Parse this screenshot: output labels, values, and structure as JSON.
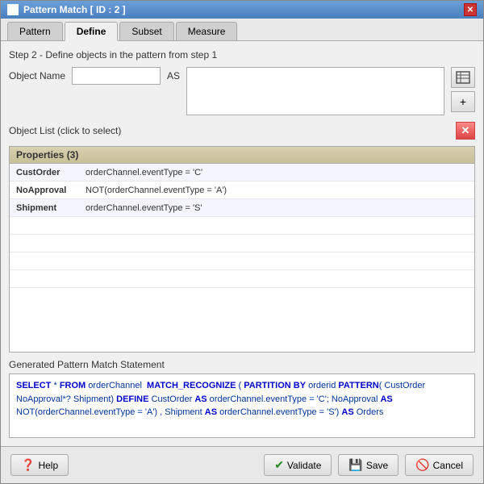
{
  "window": {
    "title": "Pattern Match [ ID : 2 ]",
    "close_label": "✕"
  },
  "tabs": [
    {
      "id": "pattern",
      "label": "Pattern",
      "active": false
    },
    {
      "id": "define",
      "label": "Define",
      "active": true
    },
    {
      "id": "subset",
      "label": "Subset",
      "active": false
    },
    {
      "id": "measure",
      "label": "Measure",
      "active": false
    }
  ],
  "content": {
    "step_label": "Step 2 - Define objects in the pattern from step 1",
    "object_name_label": "Object Name",
    "as_label": "AS",
    "object_list_label": "Object List (click to select)",
    "properties_header": "Properties (3)",
    "properties": [
      {
        "name": "CustOrder",
        "value": "orderChannel.eventType = 'C'"
      },
      {
        "name": "NoApproval",
        "value": "NOT(orderChannel.eventType = 'A')"
      },
      {
        "name": "Shipment",
        "value": "orderChannel.eventType = 'S'"
      }
    ],
    "empty_rows": 4
  },
  "generated": {
    "label": "Generated Pattern Match Statement",
    "text": "SELECT * FROM orderChannel  MATCH_RECOGNIZE ( PARTITION BY orderid PATTERN( CustOrder NoApproval*? Shipment) DEFINE CustOrder AS orderChannel.eventType = 'C'; NoApproval AS NOT(orderChannel.eventType = 'A') , Shipment AS orderChannel.eventType = 'S') AS Orders"
  },
  "buttons": {
    "icon1": "⊞",
    "icon2": "+",
    "delete": "✕",
    "help": "Help",
    "validate": "Validate",
    "save": "Save",
    "cancel": "Cancel"
  }
}
